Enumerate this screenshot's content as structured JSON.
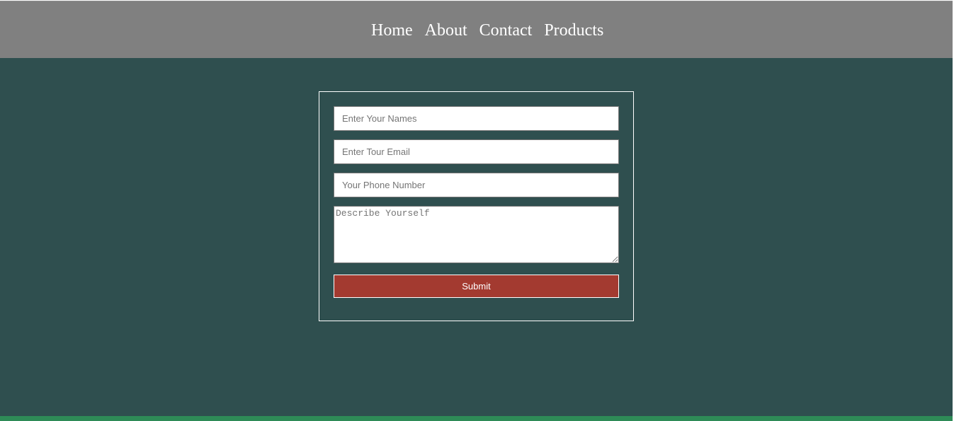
{
  "nav": {
    "items": [
      {
        "label": "Home"
      },
      {
        "label": "About"
      },
      {
        "label": "Contact"
      },
      {
        "label": "Products"
      }
    ]
  },
  "form": {
    "name_placeholder": "Enter Your Names",
    "email_placeholder": "Enter Tour Email",
    "phone_placeholder": "Your Phone Number",
    "describe_placeholder": "Describe Yourself",
    "submit_label": "Submit"
  },
  "colors": {
    "nav_background": "#808080",
    "main_background": "#2f4f4f",
    "submit_background": "#a33a30",
    "footer_strip": "#2e8b57"
  }
}
